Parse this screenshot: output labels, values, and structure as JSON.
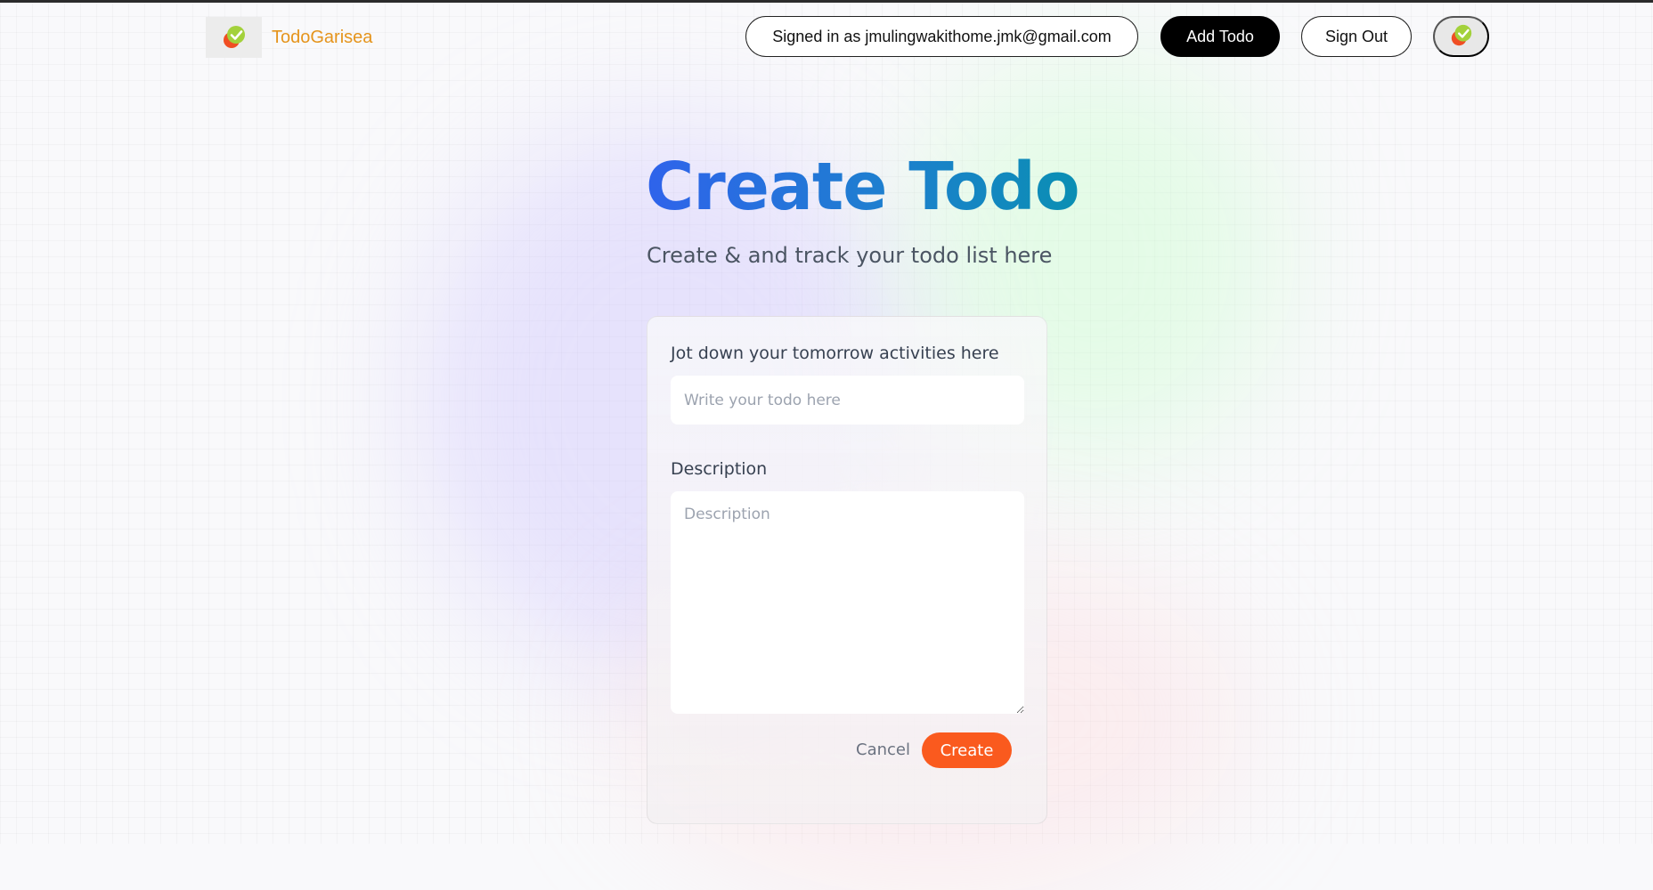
{
  "brand": {
    "name": "TodoGarisea",
    "logo_icon": "check-badge-icon"
  },
  "nav": {
    "signed_in_text": "Signed in as jmulingwakithome.jmk@gmail.com",
    "add_todo_label": "Add Todo",
    "sign_out_label": "Sign Out",
    "avatar_icon": "check-badge-icon"
  },
  "page": {
    "title": "Create Todo",
    "subtitle": "Create & and track your todo list here"
  },
  "form": {
    "title_label": "Jot down your tomorrow activities here",
    "title_value": "",
    "title_placeholder": "Write your todo here",
    "description_label": "Description",
    "description_value": "",
    "description_placeholder": "Description",
    "cancel_label": "Cancel",
    "create_label": "Create"
  },
  "colors": {
    "brand_text": "#e5941c",
    "heading_gradient_start": "#2f63eb",
    "heading_gradient_end": "#0a8fb3",
    "create_button": "#fa5a1e",
    "add_todo_button": "#000000"
  }
}
